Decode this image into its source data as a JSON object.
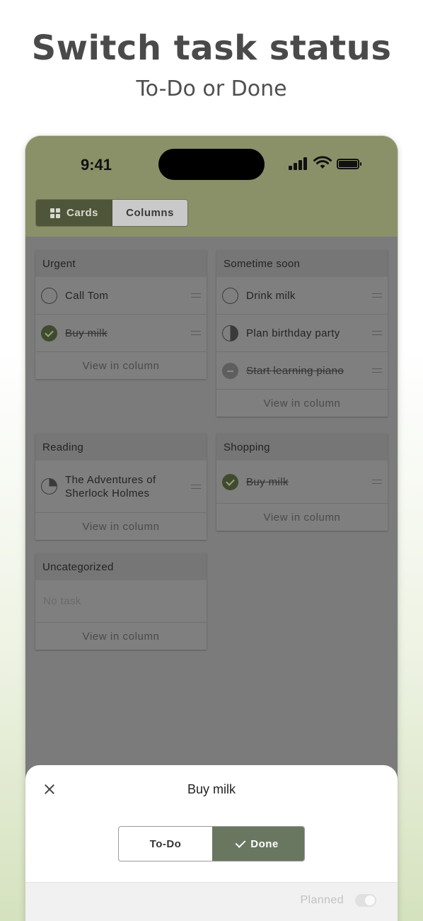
{
  "hero": {
    "title": "Switch task status",
    "subtitle": "To-Do or Done"
  },
  "statusbar": {
    "time": "9:41"
  },
  "view_switch": {
    "cards": "Cards",
    "columns": "Columns",
    "selected": "Cards"
  },
  "cards": [
    {
      "title": "Urgent",
      "tasks": [
        {
          "text": "Call Tom",
          "status": "todo"
        },
        {
          "text": "Buy milk",
          "status": "done"
        }
      ],
      "view_label": "View in column"
    },
    {
      "title": "Sometime soon",
      "tasks": [
        {
          "text": "Drink milk",
          "status": "todo"
        },
        {
          "text": "Plan birthday party",
          "status": "half"
        },
        {
          "text": "Start learning piano",
          "status": "cancelled"
        }
      ],
      "view_label": "View in column"
    },
    {
      "title": "Reading",
      "tasks": [
        {
          "text": "The Adventures of Sherlock Holmes",
          "status": "quarter"
        }
      ],
      "view_label": "View in column"
    },
    {
      "title": "Shopping",
      "tasks": [
        {
          "text": "Buy milk",
          "status": "done"
        }
      ],
      "view_label": "View in column"
    },
    {
      "title": "Uncategorized",
      "empty_text": "No task",
      "view_label": "View in column"
    }
  ],
  "sheet": {
    "title": "Buy milk",
    "options": {
      "todo": "To-Do",
      "done": "Done",
      "selected": "Done"
    },
    "planned_label": "Planned",
    "planned_on": false
  },
  "colors": {
    "accent": "#6a7760",
    "topbar": "#8a9168",
    "dark_segment": "#4e5538"
  }
}
